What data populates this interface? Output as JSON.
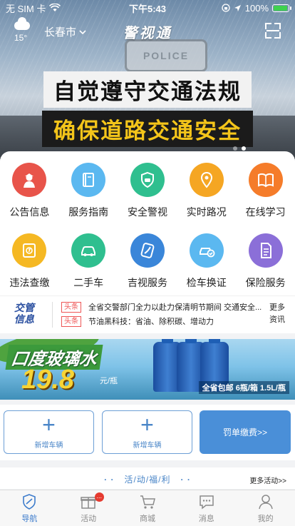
{
  "status_bar": {
    "carrier": "无 SIM 卡",
    "time": "下午5:43",
    "battery": "100%",
    "battery_level": 1.0
  },
  "header": {
    "temperature": "15°",
    "city": "长春市",
    "title": "警视通"
  },
  "banner": {
    "line1": "自觉遵守交通法规",
    "line2": "确保道路交通安全",
    "sign_text": "POLICE",
    "slides_total": 2,
    "active_slide": 1
  },
  "grid": [
    {
      "label": "公告信息",
      "icon": "officer-icon",
      "color": "#e8544a"
    },
    {
      "label": "服务指南",
      "icon": "book-icon",
      "color": "#5bb8f0"
    },
    {
      "label": "安全警视",
      "icon": "shield-car-icon",
      "color": "#2fbf8f"
    },
    {
      "label": "实时路况",
      "icon": "location-pin-icon",
      "color": "#f5a623"
    },
    {
      "label": "在线学习",
      "icon": "open-book-icon",
      "color": "#f57c2a"
    },
    {
      "label": "违法查缴",
      "icon": "ticket-icon",
      "color": "#f5b823"
    },
    {
      "label": "二手车",
      "icon": "car-icon",
      "color": "#2fbf8f"
    },
    {
      "label": "吉视服务",
      "icon": "j-logo-icon",
      "color": "#3a86d9"
    },
    {
      "label": "检车换证",
      "icon": "car-inspection-icon",
      "color": "#5bb8f0"
    },
    {
      "label": "保险服务",
      "icon": "document-icon",
      "color": "#8b6fd8"
    }
  ],
  "news": {
    "logo_line1": "交管",
    "logo_line2": "信息",
    "items": [
      {
        "tag": "头条",
        "text": "全省交警部门全力以赴力保清明节期间 交通安全..."
      },
      {
        "tag": "头条",
        "text": "节油黑科技：省油、除积碳、增动力"
      }
    ],
    "more_line1": "更多",
    "more_line2": "资讯"
  },
  "ad": {
    "title": "口度玻璃水",
    "price": "19.8",
    "unit": "元/瓶",
    "sale": "全省包邮 6瓶/箱 1.5L/瓶"
  },
  "vehicles": {
    "add1": "新增车辆",
    "add2": "新增车辆",
    "fine": "罚单缴费>>"
  },
  "activity": {
    "title": "活/动/福/利",
    "more": "更多活动>>"
  },
  "tabs": [
    {
      "label": "导航",
      "icon": "navigation-icon",
      "active": true
    },
    {
      "label": "活动",
      "icon": "gift-icon",
      "badge": "..."
    },
    {
      "label": "商城",
      "icon": "cart-icon"
    },
    {
      "label": "消息",
      "icon": "message-icon"
    },
    {
      "label": "我的",
      "icon": "profile-icon"
    }
  ],
  "colors": {
    "primary": "#3d7ccc",
    "fine_button": "#4a8fd8",
    "tag_red": "#e55555"
  }
}
